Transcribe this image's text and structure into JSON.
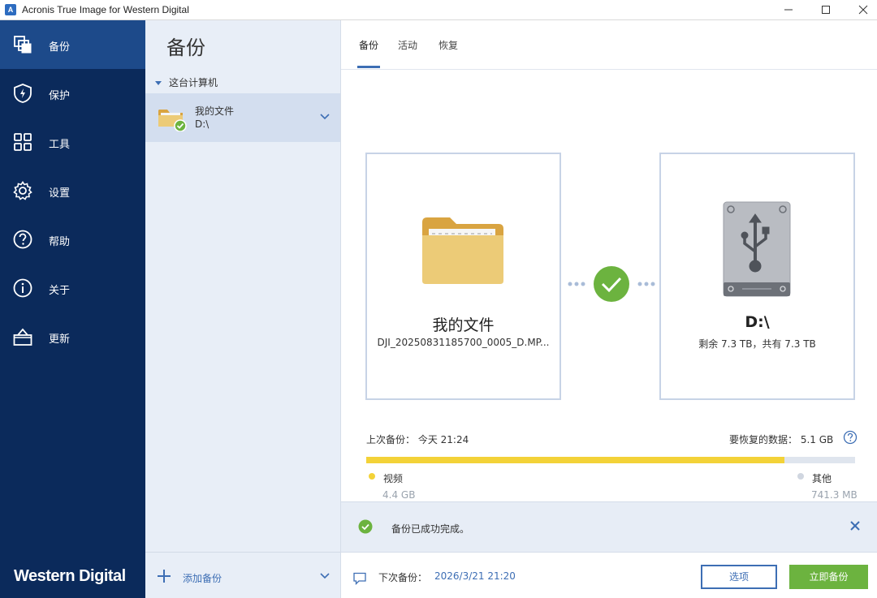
{
  "window": {
    "title": "Acronis True Image for Western Digital",
    "app_icon_letter": "A"
  },
  "nav": {
    "items": [
      {
        "label": "备份",
        "icon": "backup-icon"
      },
      {
        "label": "保护",
        "icon": "shield-icon"
      },
      {
        "label": "工具",
        "icon": "tools-grid-icon"
      },
      {
        "label": "设置",
        "icon": "gear-icon"
      },
      {
        "label": "帮助",
        "icon": "help-icon"
      },
      {
        "label": "关于",
        "icon": "info-icon"
      },
      {
        "label": "更新",
        "icon": "shopping-bag-icon"
      }
    ],
    "active_index": 0,
    "brand": "Western Digital"
  },
  "list_panel": {
    "title": "备份",
    "group_label": "这台计算机",
    "items": [
      {
        "name": "我的文件",
        "path": "D:\\"
      }
    ],
    "add_label": "添加备份"
  },
  "tabs": [
    {
      "label": "备份",
      "active": true
    },
    {
      "label": "活动",
      "active": false
    },
    {
      "label": "恢复",
      "active": false
    }
  ],
  "source": {
    "name": "我的文件",
    "detail": "DJI_20250831185700_0005_D.MP..."
  },
  "destination": {
    "name": "D:\\",
    "detail": "剩余 7.3 TB，共有 7.3 TB"
  },
  "stats": {
    "last_backup_label": "上次备份：",
    "last_backup_value": "今天 21:24",
    "recover_label": "要恢复的数据：",
    "recover_value": "5.1 GB",
    "video_fraction": 0.855,
    "legend": [
      {
        "label": "视频",
        "value": "4.4 GB",
        "color": "#f3d238"
      },
      {
        "label": "其他",
        "value": "741.3 MB",
        "color": "#d0d6e0"
      }
    ]
  },
  "notification": {
    "text": "备份已成功完成。"
  },
  "footer": {
    "next_label": "下次备份：",
    "next_value": "2026/3/21 21:20",
    "options_label": "选项",
    "backup_now_label": "立即备份"
  },
  "colors": {
    "nav_bg": "#0b2a5b",
    "nav_active": "#1d4a8a",
    "accent": "#3d6eb4",
    "success": "#6cb33f",
    "progress": "#f3d238"
  }
}
